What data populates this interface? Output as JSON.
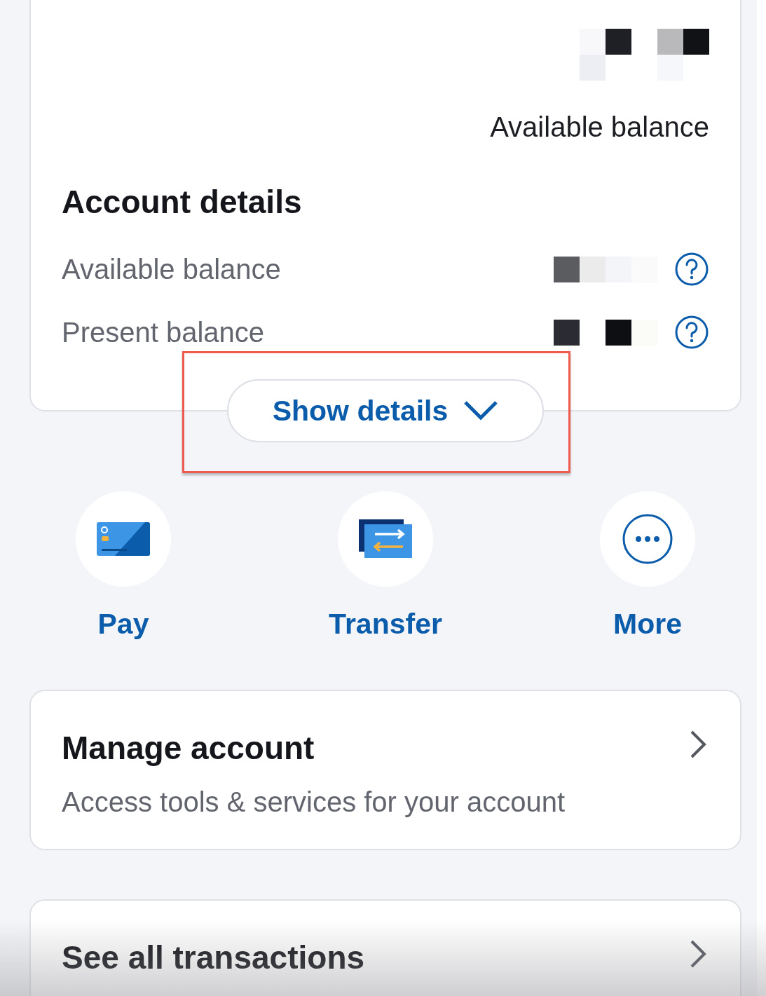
{
  "balance_header": {
    "label": "Available balance"
  },
  "account_details": {
    "title": "Account details",
    "rows": [
      {
        "label": "Available balance"
      },
      {
        "label": "Present balance"
      }
    ],
    "toggle": {
      "label": "Show details",
      "expanded": false
    }
  },
  "actions": [
    {
      "kind": "pay",
      "label": "Pay"
    },
    {
      "kind": "transfer",
      "label": "Transfer"
    },
    {
      "kind": "more",
      "label": "More"
    }
  ],
  "links": [
    {
      "title": "Manage account",
      "subtitle": "Access tools & services for your account"
    },
    {
      "title": "See all transactions"
    }
  ]
}
